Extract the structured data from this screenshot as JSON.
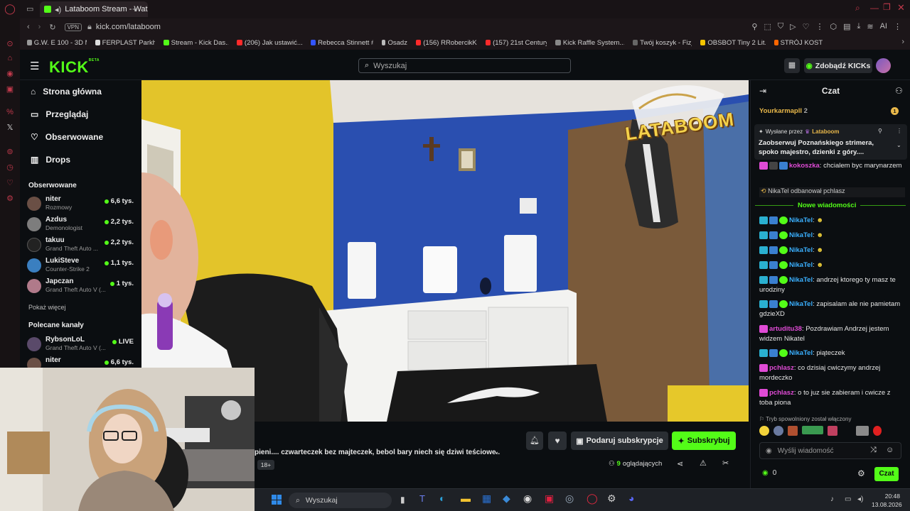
{
  "browser": {
    "tab_title": "Lataboom Stream - Wat",
    "url": "kick.com/lataboom",
    "vpn_label": "VPN",
    "bookmarks": [
      {
        "label": "G.W. E 100 - 3D M...",
        "color": "#999999"
      },
      {
        "label": "FERPLAST Parkho...",
        "color": "#dddddd"
      },
      {
        "label": "Stream - Kick Das...",
        "color": "#53fc18"
      },
      {
        "label": "(206) Jak ustawić...",
        "color": "#ff2a2a"
      },
      {
        "label": "Rebecca Stinnett #...",
        "color": "#3355ff"
      },
      {
        "label": "Osadzeni",
        "color": "#bbbbbb"
      },
      {
        "label": "(156) RRobercikK...",
        "color": "#ff2a2a"
      },
      {
        "label": "(157) 21st Century...",
        "color": "#ff2a2a"
      },
      {
        "label": "Kick Raffle System...",
        "color": "#888888"
      },
      {
        "label": "Twój koszyk - Fizj...",
        "color": "#666666"
      },
      {
        "label": "OBSBOT Tiny 2 Lit...",
        "color": "#f5c400"
      },
      {
        "label": "STRÓJ KOSTIUM...",
        "color": "#ff6600"
      }
    ],
    "ai_label": "AI"
  },
  "header": {
    "logo_text": "KICK",
    "logo_badge": "BETA",
    "search_placeholder": "Wyszukaj",
    "kicks_button": "Zdobądź KICKs"
  },
  "sidebar": {
    "nav": [
      {
        "label": "Strona główna",
        "icon": "home-icon"
      },
      {
        "label": "Przeglądaj",
        "icon": "browse-icon"
      },
      {
        "label": "Obserwowane",
        "icon": "heart-icon"
      },
      {
        "label": "Drops",
        "icon": "drops-icon"
      }
    ],
    "followed_title": "Obserwowane",
    "followed": [
      {
        "name": "niter",
        "category": "Rozmowy",
        "viewers": "6,6 tys."
      },
      {
        "name": "Azdus",
        "category": "Demonologist",
        "viewers": "2,2 tys."
      },
      {
        "name": "takuu",
        "category": "Grand Theft Auto ...",
        "viewers": "2,2 tys."
      },
      {
        "name": "LukiSteve",
        "category": "Counter-Strike 2",
        "viewers": "1,1 tys."
      },
      {
        "name": "Japczan",
        "category": "Grand Theft Auto V (...",
        "viewers": "1 tys."
      }
    ],
    "show_more": "Pokaż więcej",
    "recommended_title": "Polecane kanały",
    "recommended": [
      {
        "name": "RybsonLoL",
        "category": "Grand Theft Auto V (...",
        "viewers": "LIVE"
      },
      {
        "name": "niter",
        "category": "",
        "viewers": "6,6 tys."
      }
    ]
  },
  "stream": {
    "overlay_logo": "LATABOOM",
    "title_scroll": "pieni.... czwarteczek bez majteczek, bebol bary niech się dziwi teściowe...",
    "age_badge": "18+",
    "gift_sub_button": "Podaruj subskrypcje",
    "subscribe_button": "Subskrybuj",
    "viewers_count": "9",
    "viewers_label": "oglądających"
  },
  "chat": {
    "title": "Czat",
    "top_user": "Yourkarmapll",
    "top_user_count": "2",
    "top_user_badge": "1",
    "pinned_by_label": "Wysłane przez",
    "pinned_by_user": "Lataboom",
    "pinned_text": "Zaobserwuj Poznańskiego strimera, spoko majestro, dzienki z góry....",
    "new_messages_label": "Nowe wiadomości",
    "messages": [
      {
        "user": "kokoszka",
        "color": "#e04bd6",
        "text": "chcialem byc marynarzem"
      },
      {
        "user": "NikaTel",
        "color": "#3ab0ff",
        "text": ""
      },
      {
        "user": "NikaTel",
        "color": "#3ab0ff",
        "text": ""
      },
      {
        "user": "NikaTel",
        "color": "#3ab0ff",
        "text": ""
      },
      {
        "user": "NikaTel",
        "color": "#3ab0ff",
        "text": ""
      },
      {
        "user": "NikaTel",
        "color": "#3ab0ff",
        "text": "andrzej ktorego ty masz te urodziny"
      },
      {
        "user": "NikaTel",
        "color": "#3ab0ff",
        "text": "zapisalam ale nie pamietam gdzieXD"
      },
      {
        "user": "artuditu38",
        "color": "#e04bd6",
        "text": "Pozdrawiam Andrzej jestem widzem Nikatel"
      },
      {
        "user": "NikaTel",
        "color": "#3ab0ff",
        "text": "piąteczek"
      },
      {
        "user": "pchlasz",
        "color": "#e04bd6",
        "text": "co dzisiaj cwiczymy andrzej mordeczko"
      },
      {
        "user": "pchlasz",
        "color": "#e04bd6",
        "text": "o to juz sie zabieram i cwicze z toba piona"
      }
    ],
    "follow_event_user": "NikaTel",
    "follow_event_text": "odbanował",
    "follow_event_target": "pchlasz",
    "slow_mode_text": "Tryb spowolniony został włączony",
    "input_placeholder": "Wyślij wiadomość",
    "points": "0",
    "send_button": "Czat"
  },
  "taskbar": {
    "search_placeholder": "Wyszukaj",
    "time": "20:48",
    "date": "13.08.2026"
  }
}
